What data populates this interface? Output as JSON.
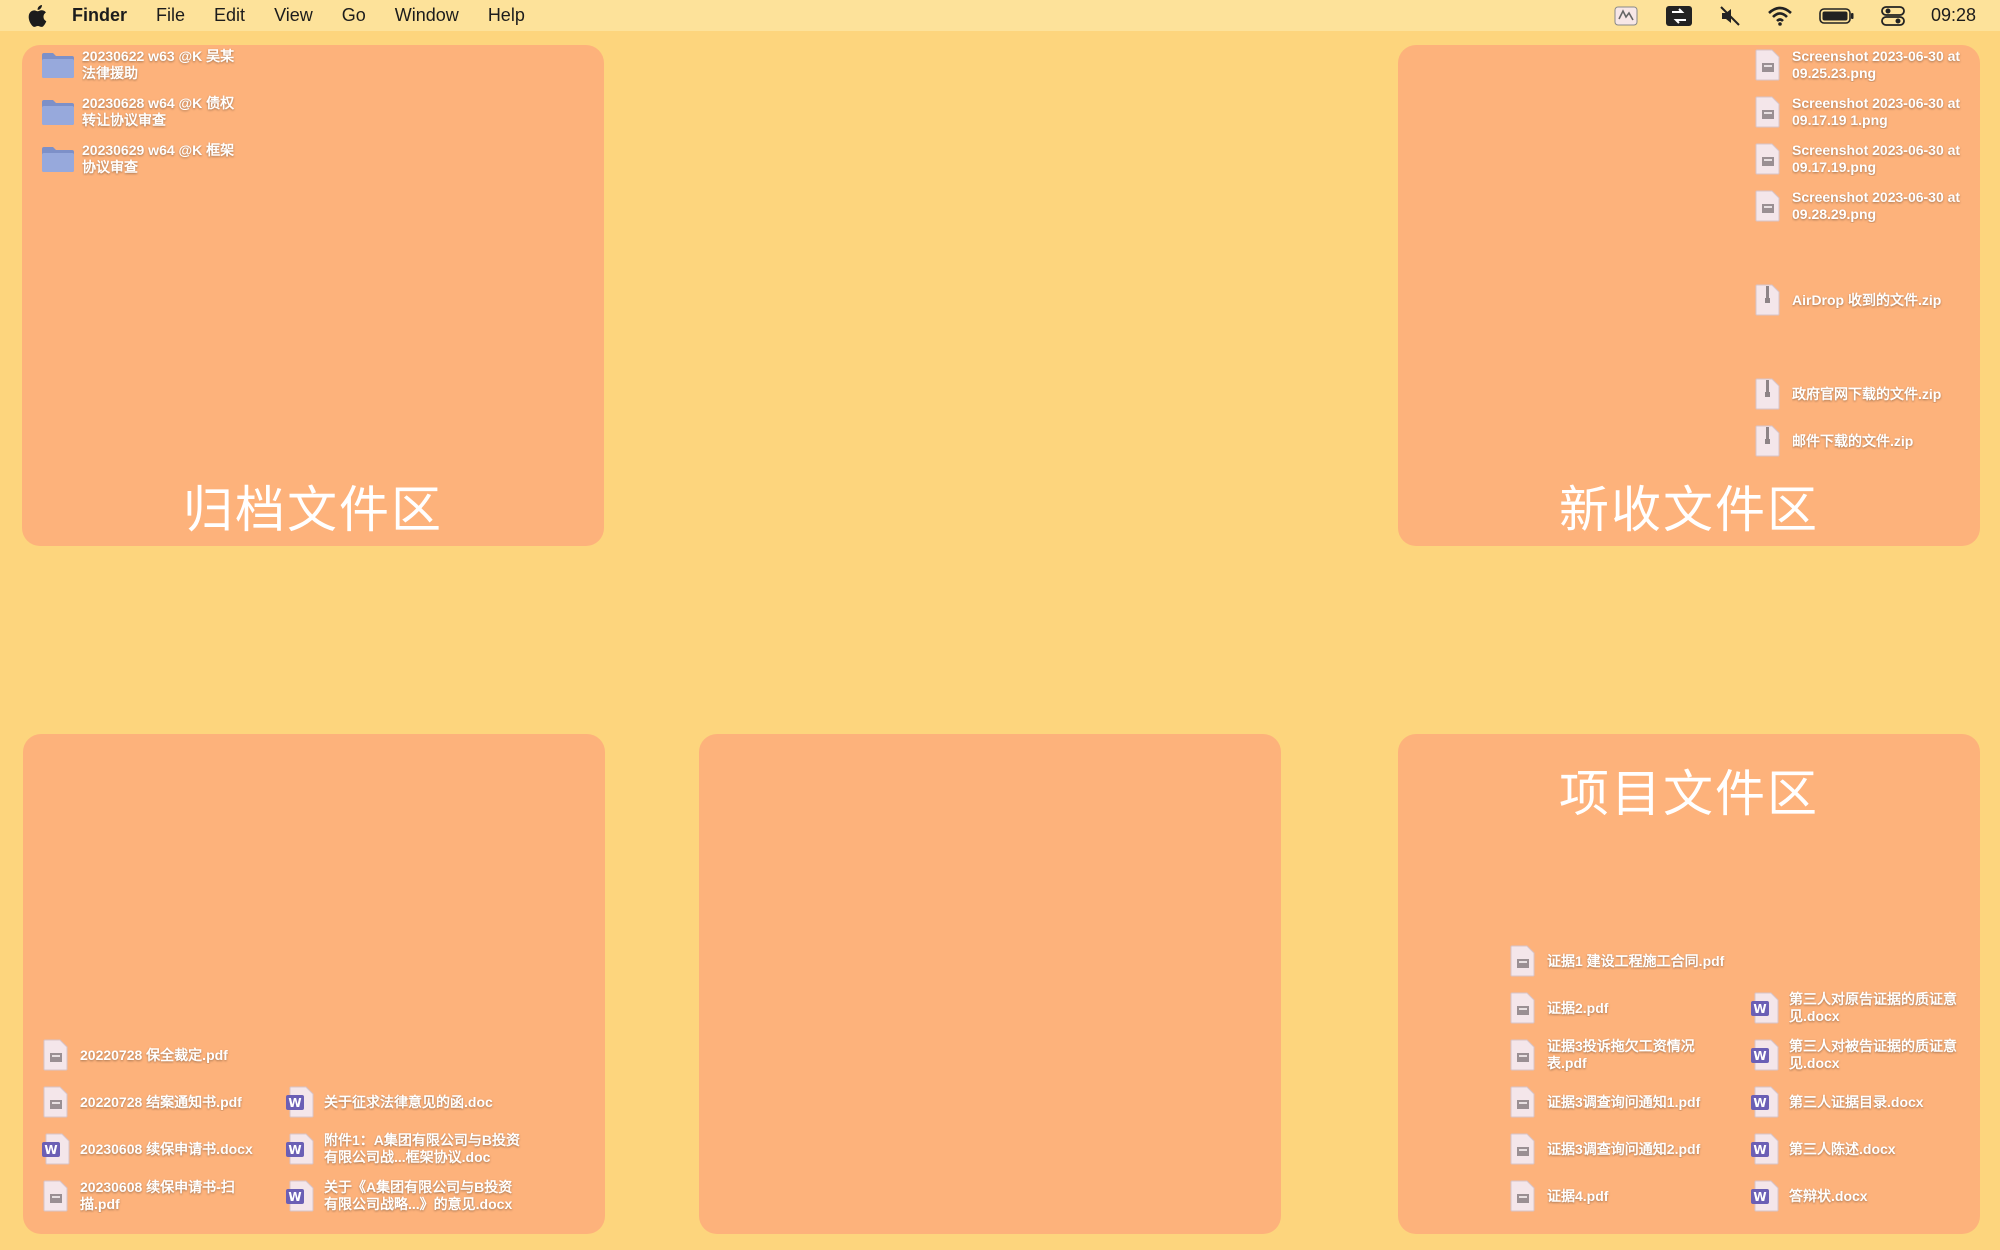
{
  "menubar": {
    "app": "Finder",
    "items": [
      "File",
      "Edit",
      "View",
      "Go",
      "Window",
      "Help"
    ],
    "clock": "09:28"
  },
  "zones": {
    "archive": {
      "title": "归档文件区"
    },
    "incoming": {
      "title": "新收文件区"
    },
    "project": {
      "title": "项目文件区"
    }
  },
  "archive_files": [
    {
      "name": "20230622 w63 @K 吴某法律援助",
      "icon": "folder-icon"
    },
    {
      "name": "20230628 w64 @K 债权转让协议审查",
      "icon": "folder-icon"
    },
    {
      "name": "20230629 w64 @K 框架协议审查",
      "icon": "folder-icon"
    }
  ],
  "incoming_files": [
    {
      "name": "Screenshot 2023-06-30 at 09.25.23.png",
      "icon": "image-file-icon"
    },
    {
      "name": "Screenshot 2023-06-30 at 09.17.19 1.png",
      "icon": "image-file-icon"
    },
    {
      "name": "Screenshot 2023-06-30 at 09.17.19.png",
      "icon": "image-file-icon"
    },
    {
      "name": "Screenshot 2023-06-30 at 09.28.29.png",
      "icon": "image-file-icon"
    },
    {
      "name": "AirDrop 收到的文件.zip",
      "icon": "zip-file-icon"
    },
    {
      "name": "政府官网下载的文件.zip",
      "icon": "zip-file-icon"
    },
    {
      "name": "邮件下载的文件.zip",
      "icon": "zip-file-icon"
    }
  ],
  "bottomleft_files": {
    "col1": [
      {
        "name": "20220728 保全裁定.pdf",
        "icon": "pdf-file-icon"
      },
      {
        "name": "20220728 结案通知书.pdf",
        "icon": "pdf-file-icon"
      },
      {
        "name": "20230608 续保申请书.docx",
        "icon": "word-file-icon"
      },
      {
        "name": "20230608 续保申请书-扫描.pdf",
        "icon": "pdf-file-icon"
      }
    ],
    "col2": [
      {
        "name": "关于征求法律意见的函.doc",
        "icon": "word-file-icon"
      },
      {
        "name": "附件1：A集团有限公司与B投资有限公司战...框架协议.doc",
        "icon": "word-file-icon"
      },
      {
        "name": "关于《A集团有限公司与B投资有限公司战略...》的意见.docx",
        "icon": "word-file-icon"
      }
    ]
  },
  "project_files": {
    "col1": [
      {
        "name": "证据1 建设工程施工合同.pdf",
        "icon": "pdf-file-icon"
      },
      {
        "name": "证据2.pdf",
        "icon": "pdf-file-icon"
      },
      {
        "name": "证据3投诉拖欠工资情况表.pdf",
        "icon": "pdf-file-icon"
      },
      {
        "name": "证据3调查询问通知1.pdf",
        "icon": "pdf-file-icon"
      },
      {
        "name": "证据3调查询问通知2.pdf",
        "icon": "pdf-file-icon"
      },
      {
        "name": "证据4.pdf",
        "icon": "pdf-file-icon"
      }
    ],
    "col2": [
      {
        "name": "第三人对原告证据的质证意见.docx",
        "icon": "word-file-icon"
      },
      {
        "name": "第三人对被告证据的质证意见.docx",
        "icon": "word-file-icon"
      },
      {
        "name": "第三人证据目录.docx",
        "icon": "word-file-icon"
      },
      {
        "name": "第三人陈述.docx",
        "icon": "word-file-icon"
      },
      {
        "name": "答辩状.docx",
        "icon": "word-file-icon"
      }
    ]
  },
  "colors": {
    "desktop": "#fdd57d",
    "zone": "#fdb27b",
    "menubar": "#fde29a",
    "folder": "#8d9fd0",
    "word": "#6b5fb5"
  }
}
